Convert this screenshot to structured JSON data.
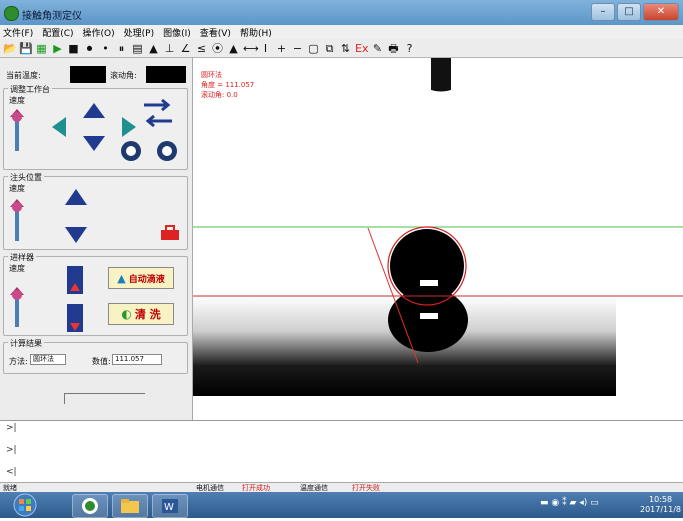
{
  "window": {
    "title": "接触角测定仪",
    "buttons": [
      "–",
      "□",
      "✕"
    ]
  },
  "menu": [
    {
      "label": "文件(F)"
    },
    {
      "label": "配置(C)"
    },
    {
      "label": "操作(O)"
    },
    {
      "label": "处理(P)"
    },
    {
      "label": "图像(I)"
    },
    {
      "label": "查看(V)"
    },
    {
      "label": "帮助(H)"
    }
  ],
  "toolbar": {
    "icons": [
      "open-icon",
      "save-icon",
      "capture-icon",
      "play-icon",
      "stop-icon",
      "record-icon",
      "dot-icon",
      "pause-icon",
      "grid-icon",
      "drop-icon",
      "baseline-icon",
      "angle-icon",
      "measure-icon",
      "circle-fit-icon",
      "triangle-icon",
      "line-icon",
      "cursor-icon",
      "plus-icon",
      "minus-icon",
      "rect-icon",
      "copy-icon",
      "sort-icon",
      "excel-icon",
      "settings-icon",
      "print-icon",
      "help-icon"
    ],
    "glyphs": [
      "📂",
      "💾",
      "▦",
      "▶",
      "■",
      "⏺",
      "•",
      "⏸",
      "▤",
      "▲",
      "⊥",
      "∠",
      "≤",
      "⦿",
      "▲",
      "⟷",
      "I",
      "+",
      "−",
      "▢",
      "⧉",
      "⇅",
      "Ex",
      "✎",
      "🖶",
      "?"
    ]
  },
  "left": {
    "temp_label": "当前温度:",
    "roll_label": "滚动角:",
    "stage_title": "调整工作台",
    "speed": "速度",
    "needle_title": "注头位置",
    "injector_title": "进样器",
    "auto_drop": "自动滴液",
    "wash": "清 洗",
    "result_title": "计算结果",
    "method_label": "方法:",
    "method_value": "圆环法",
    "value_label": "数值:",
    "value": "111.057"
  },
  "image": {
    "method": "圆环法",
    "angle": "角度 = 111.057",
    "roll": "滚动角: 0.0"
  },
  "log": [
    ">|",
    ">|",
    "<|"
  ],
  "status": {
    "ready": "就绪",
    "motor": "电机通信",
    "open_ok": "打开成功",
    "temp_comm": "温度通信",
    "open_fail": "打开失败"
  },
  "taskbar": {
    "time": "10:58",
    "date": "2017/11/8"
  }
}
